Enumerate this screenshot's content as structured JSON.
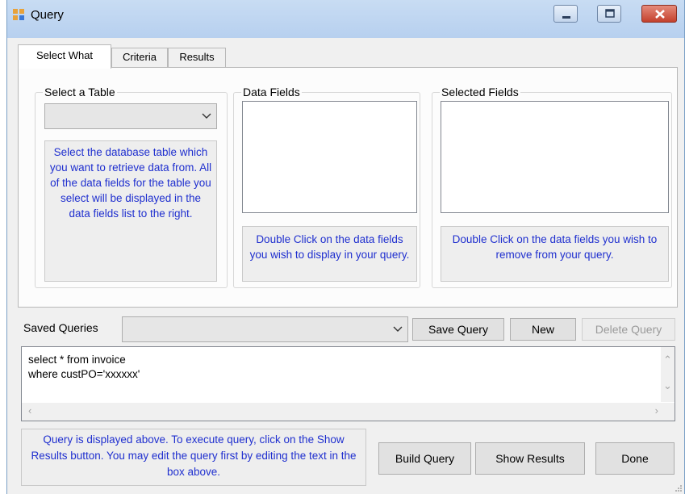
{
  "window": {
    "title": "Query"
  },
  "tabs": [
    {
      "label": "Select What",
      "active": true
    },
    {
      "label": "Criteria",
      "active": false
    },
    {
      "label": "Results",
      "active": false
    }
  ],
  "select_table": {
    "group_label": "Select a Table",
    "selected_value": "",
    "hint": "Select the database table which you want to retrieve data from.  All of the data fields for the table you select will be displayed in the data fields list to the right."
  },
  "data_fields": {
    "group_label": "Data Fields",
    "items": [],
    "hint": "Double Click on the data fields you wish to display in your query."
  },
  "selected_fields": {
    "group_label": "Selected Fields",
    "items": [],
    "hint": "Double Click on the data fields you wish to remove from your query."
  },
  "saved_queries": {
    "label": "Saved Queries",
    "selected_value": "",
    "save_label": "Save Query",
    "new_label": "New",
    "delete_label": "Delete Query"
  },
  "query_text": "select * from invoice\nwhere custPO='xxxxxx'",
  "footer": {
    "hint": "Query is displayed above. To execute query, click on the Show Results button.  You may edit the query first by editing the text in the box above.",
    "build_label": "Build Query",
    "show_label": "Show Results",
    "done_label": "Done"
  },
  "colors": {
    "hint_text": "#1f2fcf",
    "title_bar": "#c0d7f2",
    "close_button": "#c4412d"
  },
  "icons": [
    "app-icon",
    "minimize-icon",
    "maximize-icon",
    "close-icon",
    "chevron-down-icon",
    "scroll-up-icon",
    "scroll-down-icon",
    "scroll-left-icon",
    "scroll-right-icon",
    "resize-grip-icon"
  ]
}
